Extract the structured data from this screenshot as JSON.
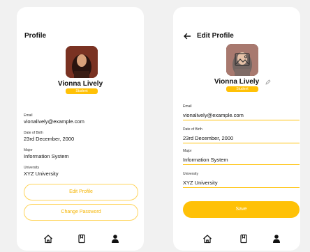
{
  "profile": {
    "title": "Profile",
    "name": "Vionna Lively",
    "badge": "Student",
    "fields": [
      {
        "label": "Email",
        "value": "vionalively@example.com"
      },
      {
        "label": "Date of Birth",
        "value": "23rd December, 2000"
      },
      {
        "label": "Major",
        "value": "Information System"
      },
      {
        "label": "University",
        "value": "XYZ University"
      }
    ],
    "edit_profile_label": "Edit Profile",
    "change_password_label": "Change Password"
  },
  "edit_profile": {
    "title": "Edit Profile",
    "name": "Vionna Lively",
    "badge": "Student",
    "fields": [
      {
        "label": "Email",
        "value": "vionalively@example.com"
      },
      {
        "label": "Date of Birth",
        "value": "23rd December, 2000"
      },
      {
        "label": "Major",
        "value": "Information System"
      },
      {
        "label": "University",
        "value": "XYZ University"
      }
    ],
    "save_label": "Save"
  },
  "icons": {
    "back": "arrow-left-icon",
    "edit": "pencil-icon",
    "photo": "image-icon",
    "nav": [
      "home-icon",
      "bookmark-icon",
      "user-icon"
    ]
  },
  "colors": {
    "accent": "#ffc107",
    "accent_text": "#f5b400",
    "background": "#f1f1f1",
    "card": "#ffffff"
  }
}
